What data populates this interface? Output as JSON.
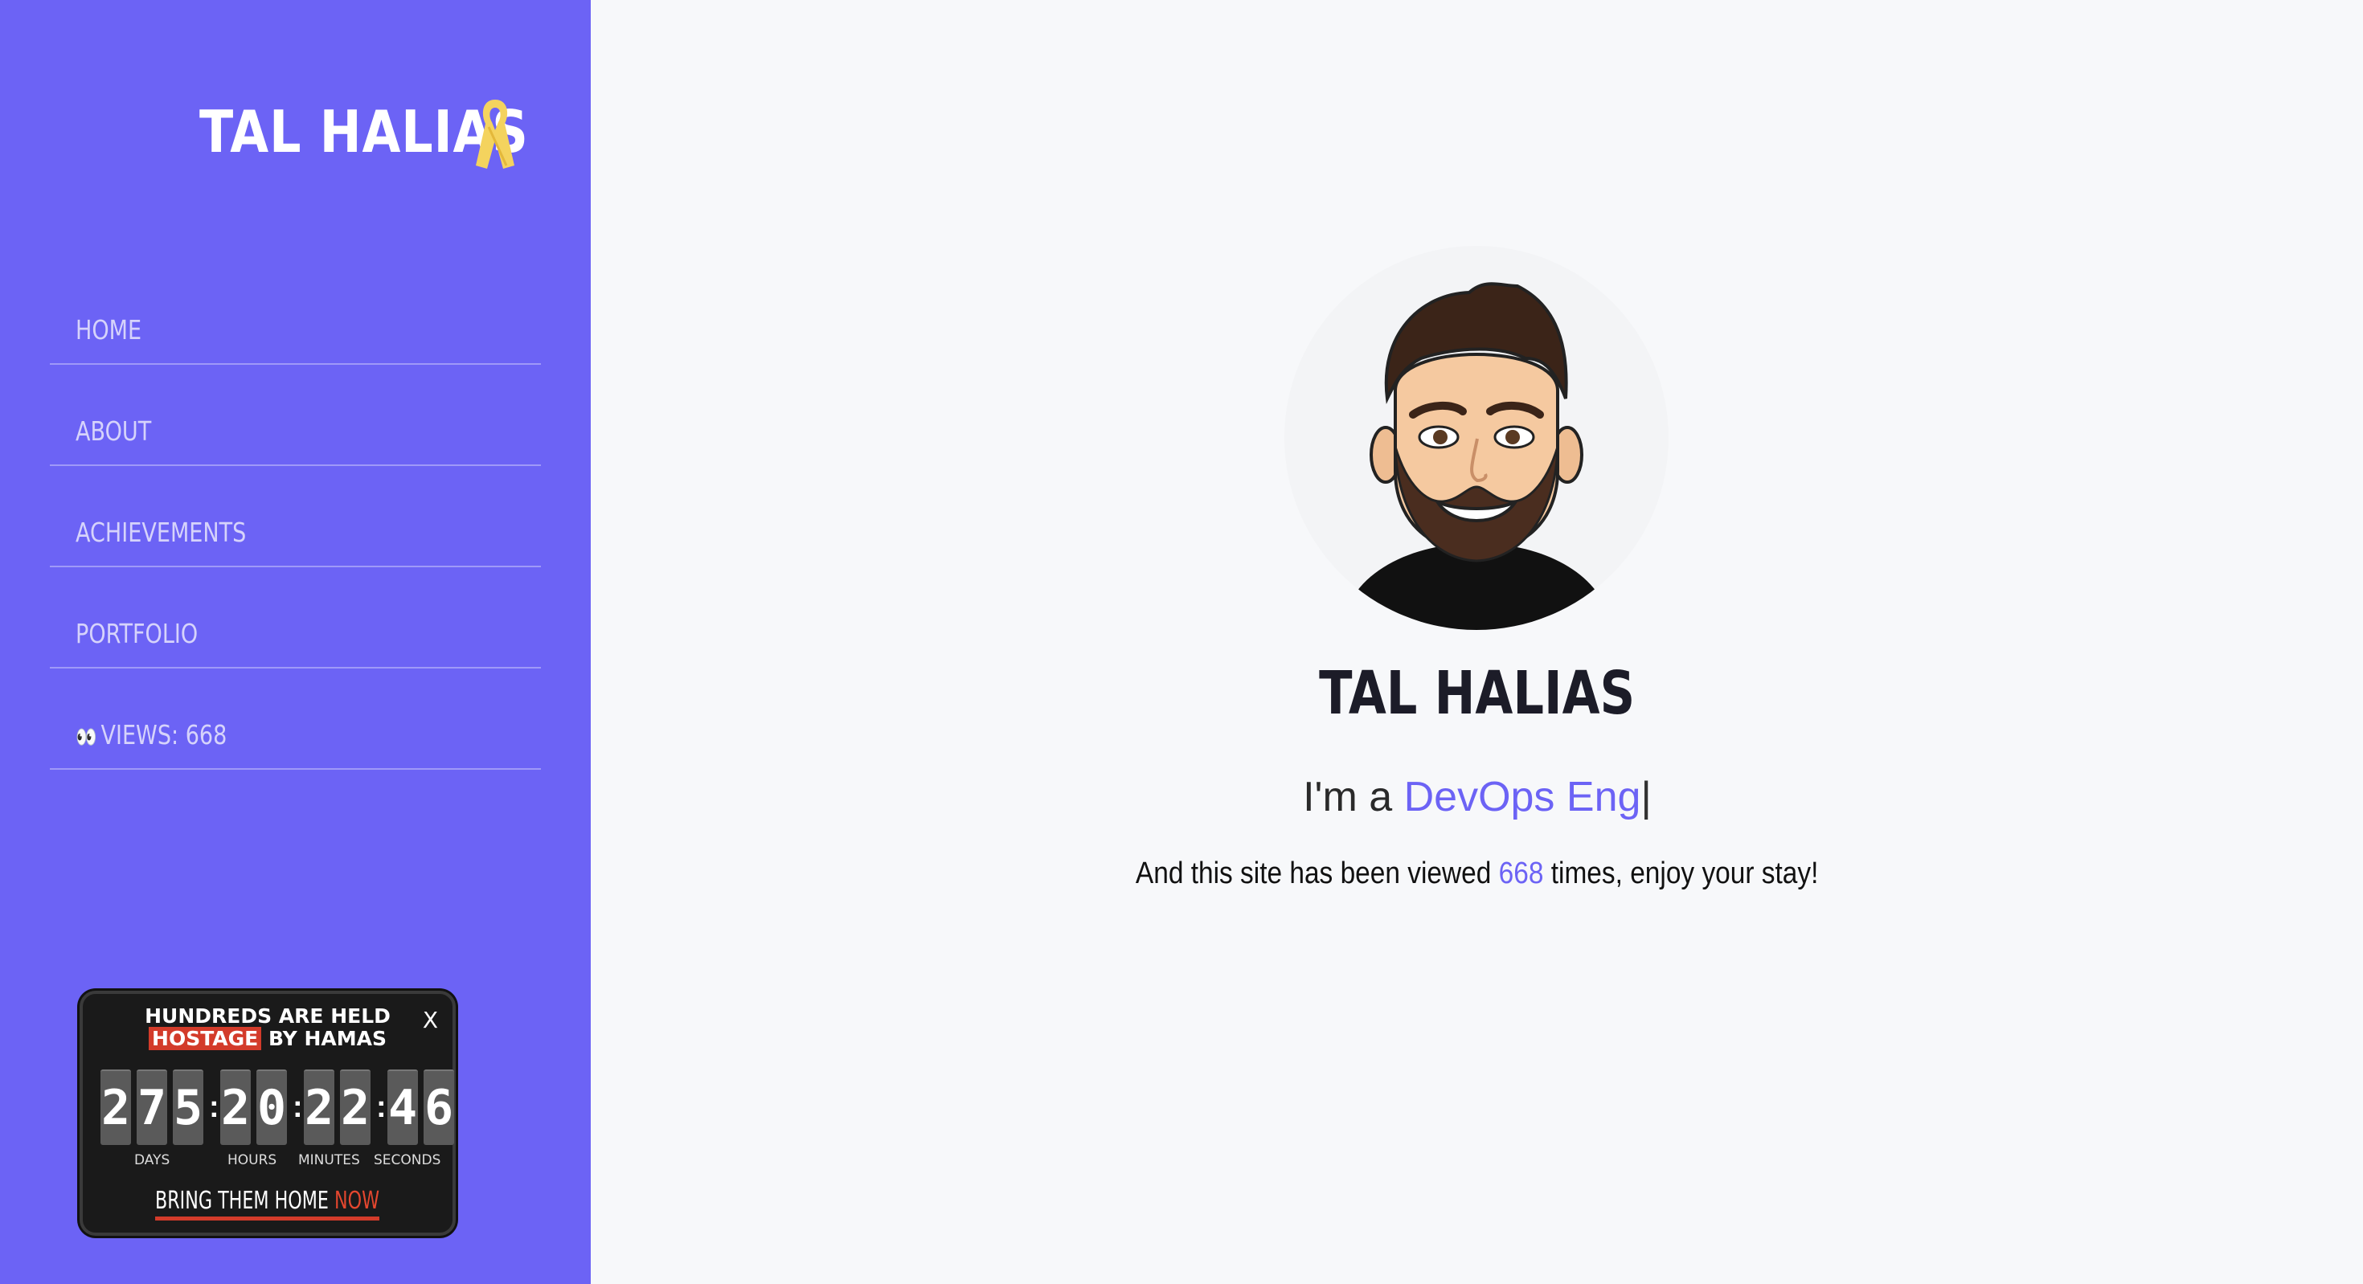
{
  "brand": {
    "name": "TAL HALIAS"
  },
  "nav": {
    "items": [
      {
        "label": "HOME"
      },
      {
        "label": "ABOUT"
      },
      {
        "label": "ACHIEVEMENTS"
      },
      {
        "label": "PORTFOLIO"
      },
      {
        "label": "VIEWS: 668",
        "icon": "eyes-icon"
      }
    ]
  },
  "hostage_widget": {
    "title_line1": "HUNDREDS ARE HELD",
    "title_highlight": "HOSTAGE",
    "title_rest": " BY HAMAS",
    "close_label": "X",
    "digits": [
      "2",
      "7",
      "5",
      "2",
      "0",
      "2",
      "2",
      "4",
      "6"
    ],
    "units": {
      "days": "DAYS",
      "hours": "HOURS",
      "minutes": "MINUTES",
      "seconds": "SECONDS"
    },
    "cta_main": "BRING THEM HOME ",
    "cta_accent": "NOW"
  },
  "hero": {
    "name": "TAL HALIAS",
    "tagline_prefix": "I'm a ",
    "tagline_typed": "DevOps Eng",
    "tagline_cursor": "|",
    "views_prefix": "And this site has been viewed ",
    "views_count": "668",
    "views_suffix": " times, enjoy your stay!"
  },
  "colors": {
    "accent": "#6c63f5",
    "background": "#f7f8fa",
    "ribbon": "#f4d35e",
    "hostage_red": "#d33b2a"
  }
}
